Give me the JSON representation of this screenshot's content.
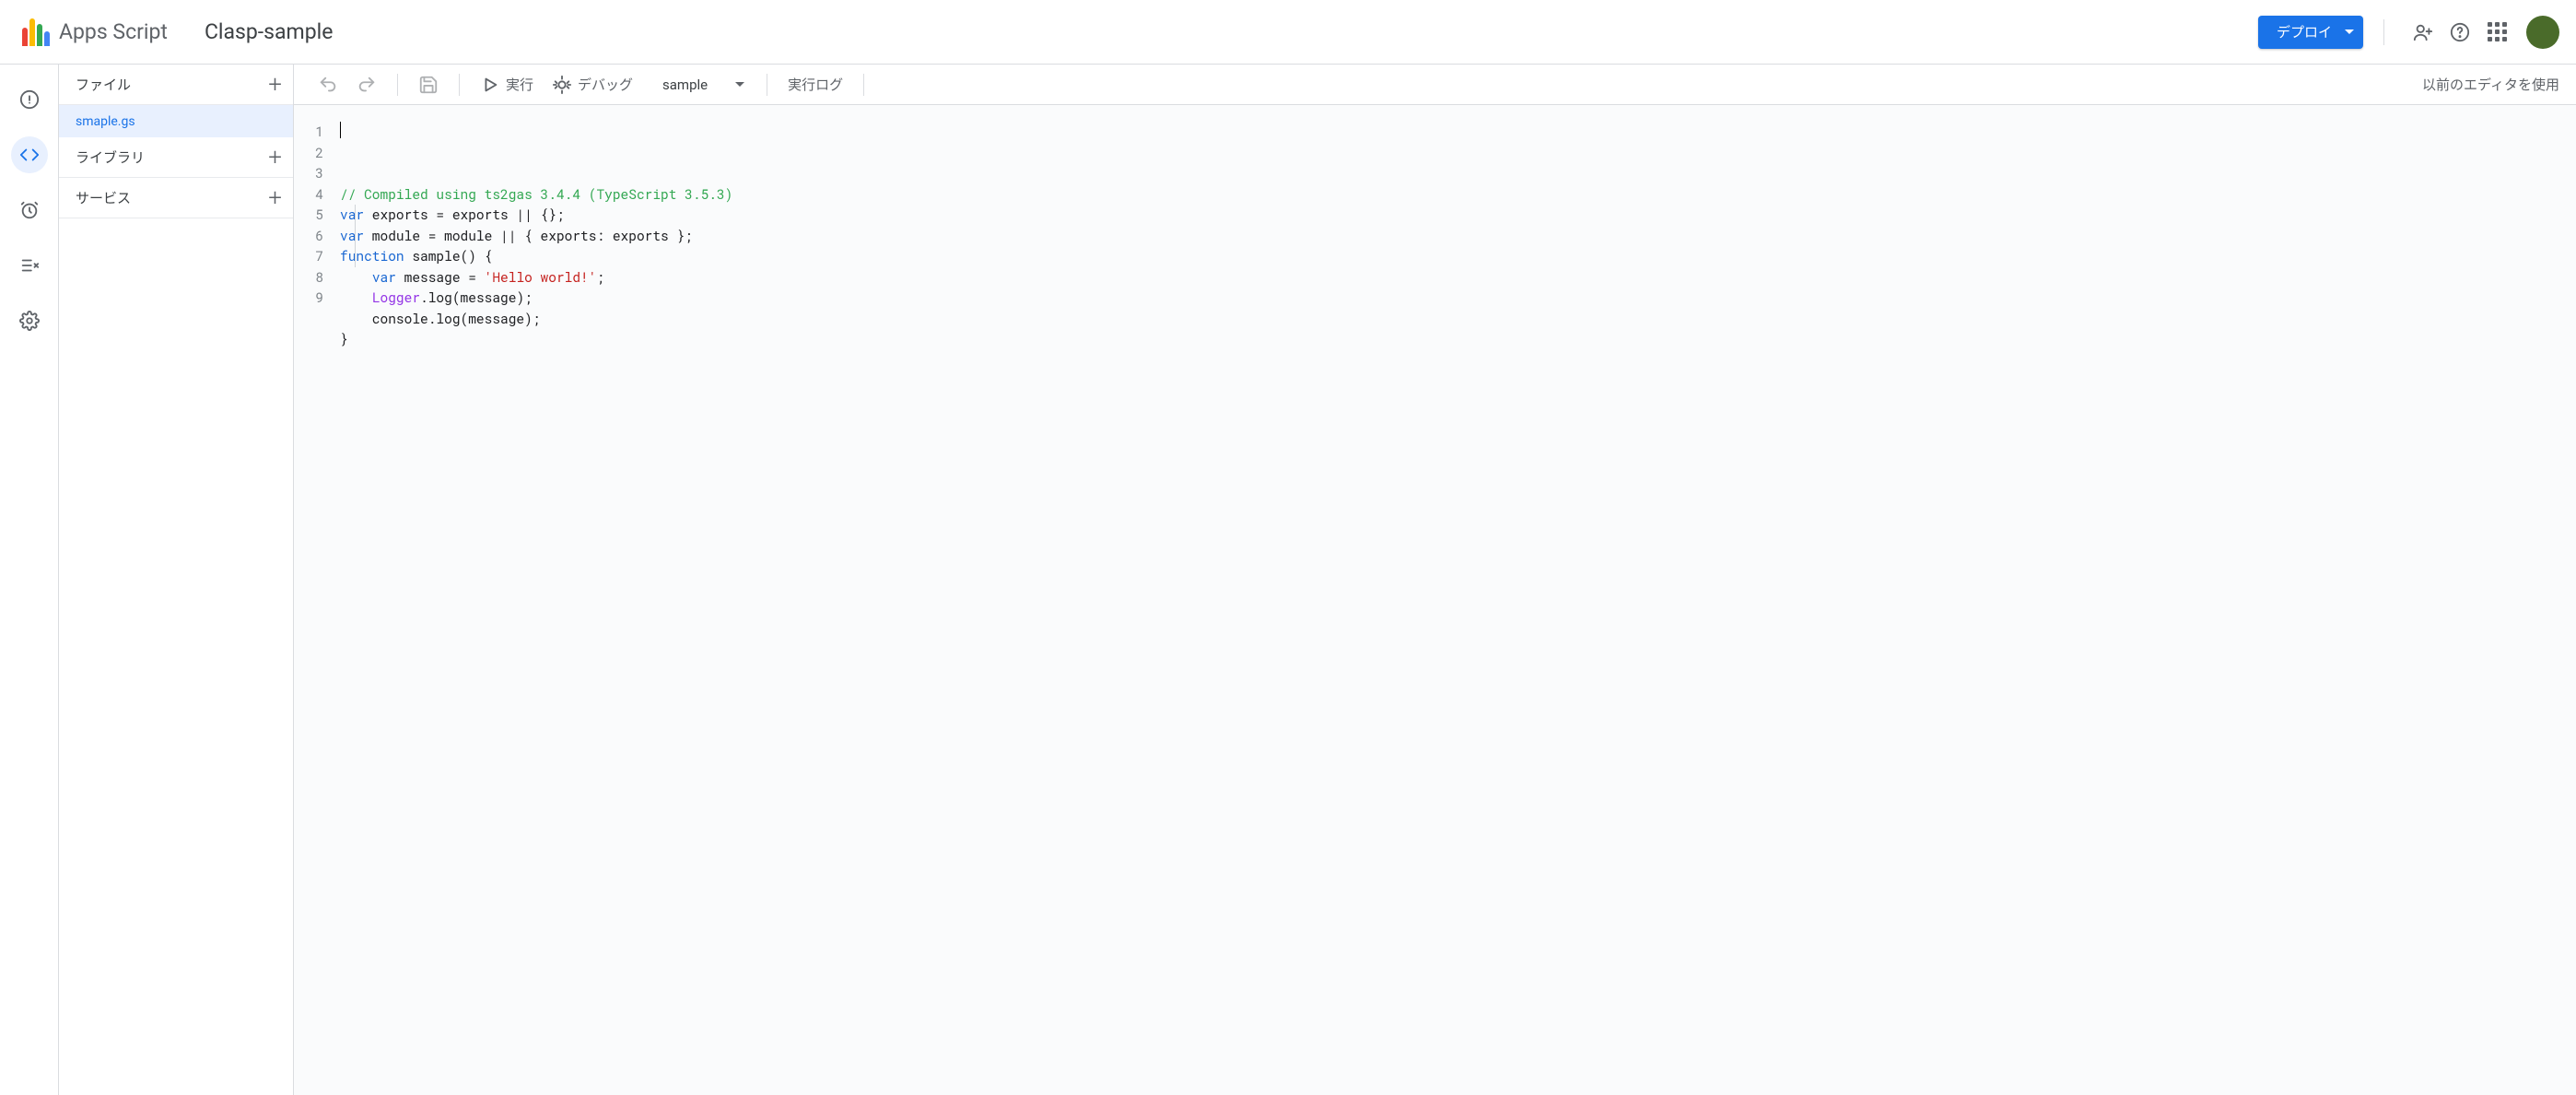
{
  "header": {
    "product": "Apps Script",
    "project": "Clasp-sample",
    "deploy_label": "デプロイ"
  },
  "sidebar": {
    "files_label": "ファイル",
    "libraries_label": "ライブラリ",
    "services_label": "サービス",
    "files": [
      {
        "name": "smaple.gs",
        "active": true
      }
    ]
  },
  "toolbar": {
    "run_label": "実行",
    "debug_label": "デバッグ",
    "selected_function": "sample",
    "log_label": "実行ログ",
    "legacy_editor_label": "以前のエディタを使用"
  },
  "editor": {
    "line_count": 9,
    "lines": [
      {
        "tokens": [
          {
            "t": "// Compiled using ts2gas 3.4.4 (TypeScript 3.5.3)",
            "c": "c-comment"
          }
        ]
      },
      {
        "tokens": [
          {
            "t": "var",
            "c": "c-kw"
          },
          {
            "t": " exports = exports || {};",
            "c": "c-txt"
          }
        ]
      },
      {
        "tokens": [
          {
            "t": "var",
            "c": "c-kw"
          },
          {
            "t": " module = module || { exports: exports };",
            "c": "c-txt"
          }
        ]
      },
      {
        "tokens": [
          {
            "t": "function",
            "c": "c-kw"
          },
          {
            "t": " sample() {",
            "c": "c-txt"
          }
        ]
      },
      {
        "tokens": [
          {
            "t": "    ",
            "c": ""
          },
          {
            "t": "var",
            "c": "c-kw"
          },
          {
            "t": " message = ",
            "c": "c-txt"
          },
          {
            "t": "'Hello world!'",
            "c": "c-str"
          },
          {
            "t": ";",
            "c": "c-txt"
          }
        ]
      },
      {
        "tokens": [
          {
            "t": "    ",
            "c": ""
          },
          {
            "t": "Logger",
            "c": "c-obj"
          },
          {
            "t": ".log(message);",
            "c": "c-txt"
          }
        ]
      },
      {
        "tokens": [
          {
            "t": "    console.log(message);",
            "c": "c-txt"
          }
        ]
      },
      {
        "tokens": [
          {
            "t": "}",
            "c": "c-txt"
          }
        ]
      },
      {
        "tokens": []
      }
    ]
  }
}
